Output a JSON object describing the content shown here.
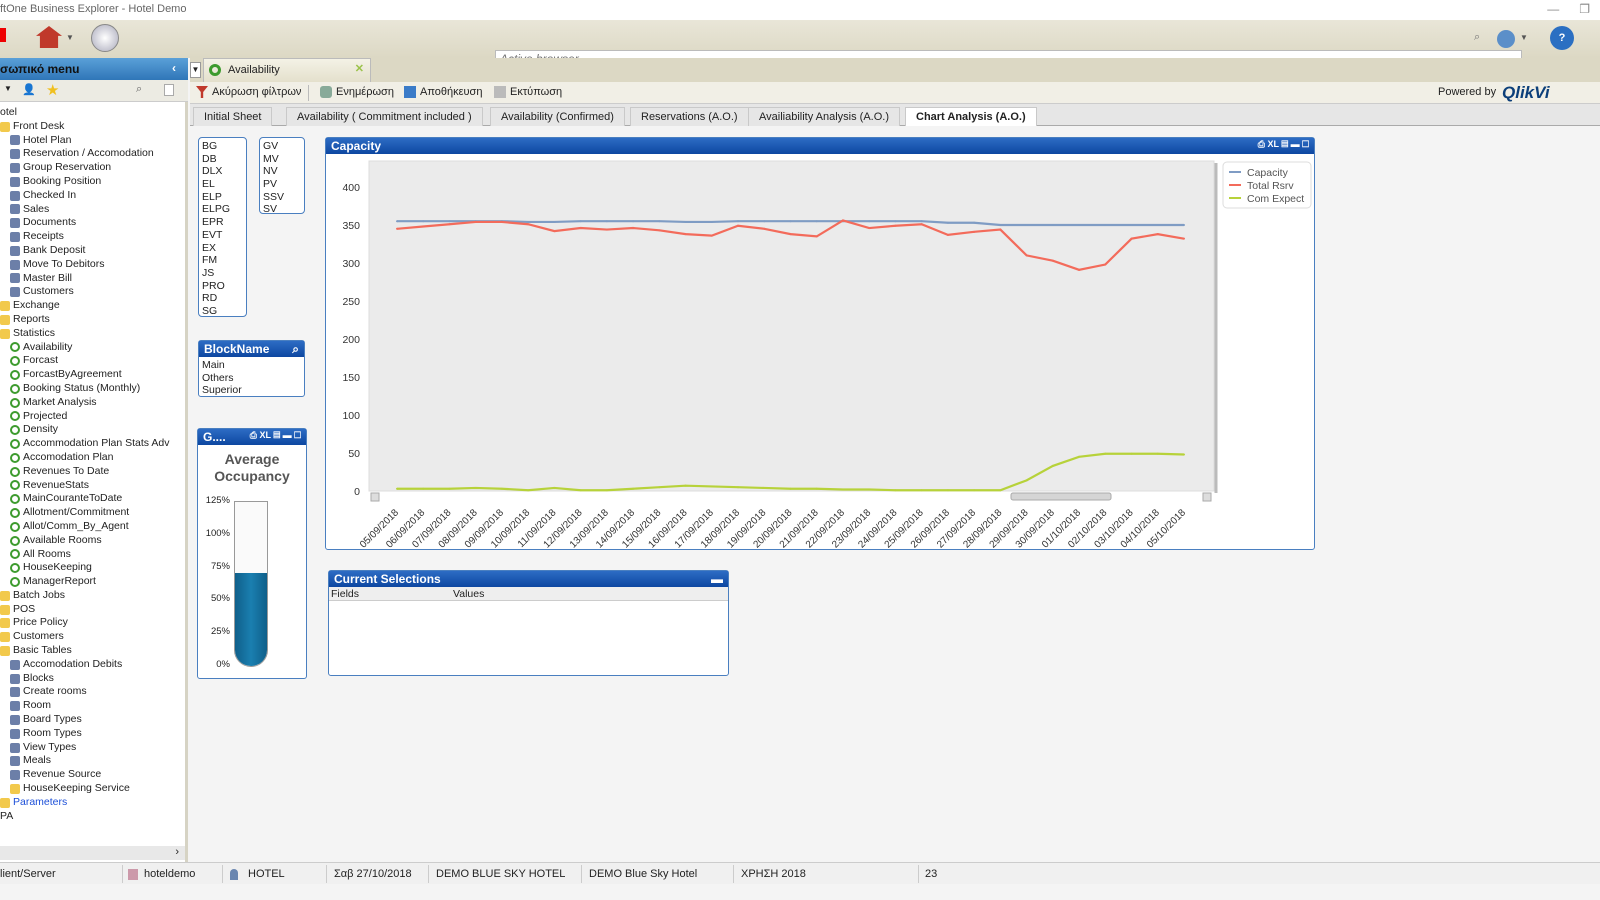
{
  "window": {
    "title": "ftOne Business Explorer - Hotel Demo"
  },
  "toolbar": {
    "browser_placeholder": "Active browser"
  },
  "sidebar": {
    "title": "σωπικό menu",
    "items": [
      {
        "label": "otel",
        "lvl": 0,
        "icon": "none"
      },
      {
        "label": "Front Desk",
        "lvl": 0,
        "icon": "folder"
      },
      {
        "label": "Hotel Plan",
        "lvl": 1,
        "icon": "doc"
      },
      {
        "label": "Reservation / Accomodation",
        "lvl": 1,
        "icon": "doc"
      },
      {
        "label": "Group Reservation",
        "lvl": 1,
        "icon": "doc"
      },
      {
        "label": "Booking Position",
        "lvl": 1,
        "icon": "doc"
      },
      {
        "label": "Checked In",
        "lvl": 1,
        "icon": "doc"
      },
      {
        "label": "Sales",
        "lvl": 1,
        "icon": "doc"
      },
      {
        "label": "Documents",
        "lvl": 1,
        "icon": "doc"
      },
      {
        "label": "Receipts",
        "lvl": 1,
        "icon": "doc"
      },
      {
        "label": "Bank Deposit",
        "lvl": 1,
        "icon": "doc"
      },
      {
        "label": "Move To Debitors",
        "lvl": 1,
        "icon": "doc"
      },
      {
        "label": "Master Bill",
        "lvl": 1,
        "icon": "doc"
      },
      {
        "label": "Customers",
        "lvl": 1,
        "icon": "doc"
      },
      {
        "label": "Exchange",
        "lvl": 0,
        "icon": "folder"
      },
      {
        "label": "Reports",
        "lvl": 0,
        "icon": "folder"
      },
      {
        "label": "Statistics",
        "lvl": 0,
        "icon": "folder"
      },
      {
        "label": "Availability",
        "lvl": 1,
        "icon": "stat"
      },
      {
        "label": "Forcast",
        "lvl": 1,
        "icon": "stat"
      },
      {
        "label": "ForcastByAgreement",
        "lvl": 1,
        "icon": "stat"
      },
      {
        "label": "Booking Status (Monthly)",
        "lvl": 1,
        "icon": "stat"
      },
      {
        "label": "Market Analysis",
        "lvl": 1,
        "icon": "stat"
      },
      {
        "label": "Projected",
        "lvl": 1,
        "icon": "stat"
      },
      {
        "label": "Density",
        "lvl": 1,
        "icon": "stat"
      },
      {
        "label": "Accommodation Plan Stats Adv",
        "lvl": 1,
        "icon": "stat"
      },
      {
        "label": "Accomodation Plan",
        "lvl": 1,
        "icon": "stat"
      },
      {
        "label": "Revenues To Date",
        "lvl": 1,
        "icon": "stat"
      },
      {
        "label": "RevenueStats",
        "lvl": 1,
        "icon": "stat"
      },
      {
        "label": "MainCouranteToDate",
        "lvl": 1,
        "icon": "stat"
      },
      {
        "label": "Allotment/Commitment",
        "lvl": 1,
        "icon": "stat"
      },
      {
        "label": "Allot/Comm_By_Agent",
        "lvl": 1,
        "icon": "stat"
      },
      {
        "label": "Available Rooms",
        "lvl": 1,
        "icon": "stat"
      },
      {
        "label": "All Rooms",
        "lvl": 1,
        "icon": "stat"
      },
      {
        "label": "HouseKeeping",
        "lvl": 1,
        "icon": "stat"
      },
      {
        "label": "ManagerReport",
        "lvl": 1,
        "icon": "stat"
      },
      {
        "label": "Batch Jobs",
        "lvl": 0,
        "icon": "folder"
      },
      {
        "label": "POS",
        "lvl": 0,
        "icon": "folder"
      },
      {
        "label": "Price Policy",
        "lvl": 0,
        "icon": "folder"
      },
      {
        "label": "Customers",
        "lvl": 0,
        "icon": "folder"
      },
      {
        "label": "Basic Tables",
        "lvl": 0,
        "icon": "folder"
      },
      {
        "label": "Accomodation Debits",
        "lvl": 1,
        "icon": "doc"
      },
      {
        "label": "Blocks",
        "lvl": 1,
        "icon": "doc"
      },
      {
        "label": "Create rooms",
        "lvl": 1,
        "icon": "doc"
      },
      {
        "label": "Room",
        "lvl": 1,
        "icon": "doc"
      },
      {
        "label": "Board Types",
        "lvl": 1,
        "icon": "doc"
      },
      {
        "label": "Room Types",
        "lvl": 1,
        "icon": "doc"
      },
      {
        "label": "View Types",
        "lvl": 1,
        "icon": "doc"
      },
      {
        "label": "Meals",
        "lvl": 1,
        "icon": "doc"
      },
      {
        "label": "Revenue Source",
        "lvl": 1,
        "icon": "doc"
      },
      {
        "label": "HouseKeeping Service",
        "lvl": 1,
        "icon": "folder"
      },
      {
        "label": "Parameters",
        "lvl": 0,
        "icon": "folder",
        "link": true
      },
      {
        "label": "PA",
        "lvl": 0,
        "icon": "none"
      }
    ]
  },
  "app_tab": {
    "label": "Availability"
  },
  "actions": {
    "clear_filters": "Ακύρωση φίλτρων",
    "refresh": "Ενημέρωση",
    "save": "Αποθήκευση",
    "print": "Εκτύπωση",
    "powered_by": "Powered by",
    "brand": "QlikVi"
  },
  "sheet_tabs": [
    {
      "label": "Initial Sheet"
    },
    {
      "label": "Availability  ( Commitment included )"
    },
    {
      "label": "Availability (Confirmed)"
    },
    {
      "label": "Reservations (A.O.)"
    },
    {
      "label": "Availiability Analysis (A.O.)"
    },
    {
      "label": "Chart Analysis (A.O.)",
      "active": true
    }
  ],
  "listbox_codes_1": [
    "BG",
    "DB",
    "DLX",
    "EL",
    "ELP",
    "ELPG",
    "EPR",
    "EVT",
    "EX",
    "FM",
    "JS",
    "PRO",
    "RD",
    "SG"
  ],
  "listbox_codes_2": [
    "GV",
    "MV",
    "NV",
    "PV",
    "SSV",
    "SV"
  ],
  "blockname": {
    "title": "BlockName",
    "items": [
      "Main",
      "Others",
      "Superior"
    ]
  },
  "gauge": {
    "title": "G....",
    "label": "Average Occupancy",
    "ticks": [
      "125%",
      "100%",
      "75%",
      "50%",
      "25%",
      "0%"
    ],
    "value_percent": 72,
    "fill_color": "#1a7fb0"
  },
  "current_selections": {
    "title": "Current Selections",
    "col_fields": "Fields",
    "col_values": "Values"
  },
  "chart_data": {
    "type": "line",
    "title": "Capacity",
    "ylim": [
      0,
      400
    ],
    "yticks": [
      0,
      50,
      100,
      150,
      200,
      250,
      300,
      350,
      400
    ],
    "legend_position": "top-right",
    "grid": false,
    "categories": [
      "05/09/2018",
      "06/09/2018",
      "07/09/2018",
      "08/09/2018",
      "09/09/2018",
      "10/09/2018",
      "11/09/2018",
      "12/09/2018",
      "13/09/2018",
      "14/09/2018",
      "15/09/2018",
      "16/09/2018",
      "17/09/2018",
      "18/09/2018",
      "19/09/2018",
      "20/09/2018",
      "21/09/2018",
      "22/09/2018",
      "23/09/2018",
      "24/09/2018",
      "25/09/2018",
      "26/09/2018",
      "27/09/2018",
      "28/09/2018",
      "29/09/2018",
      "30/09/2018",
      "01/10/2018",
      "02/10/2018",
      "03/10/2018",
      "04/10/2018",
      "05/10/2018"
    ],
    "series": [
      {
        "name": "Capacity",
        "color": "#7f9cc4",
        "values": [
          355,
          355,
          355,
          355,
          355,
          354,
          354,
          355,
          355,
          355,
          355,
          354,
          354,
          355,
          355,
          355,
          355,
          355,
          355,
          355,
          355,
          353,
          353,
          350,
          350,
          350,
          350,
          350,
          350,
          350,
          350
        ]
      },
      {
        "name": "Total Rsrv",
        "color": "#f36b5b",
        "values": [
          345,
          348,
          351,
          354,
          354,
          351,
          342,
          346,
          344,
          346,
          343,
          338,
          336,
          349,
          345,
          338,
          335,
          356,
          346,
          349,
          351,
          337,
          341,
          344,
          310,
          303,
          291,
          298,
          332,
          338,
          332
        ]
      },
      {
        "name": "Com Expect",
        "color": "#b7d23a",
        "values": [
          3,
          3,
          3,
          4,
          3,
          1,
          4,
          1,
          1,
          3,
          5,
          7,
          6,
          5,
          4,
          3,
          3,
          2,
          2,
          1,
          1,
          1,
          1,
          1,
          14,
          33,
          45,
          49,
          49,
          49,
          48
        ]
      }
    ]
  },
  "statusbar": {
    "mode": "lient/Server",
    "user": "hoteldemo",
    "company": "HOTEL",
    "date": "Σαβ 27/10/2018",
    "hotel_upper": "DEMO BLUE SKY HOTEL",
    "hotel": "DEMO Blue Sky Hotel",
    "year": "ΧΡΗΣΗ 2018",
    "count": "23"
  }
}
